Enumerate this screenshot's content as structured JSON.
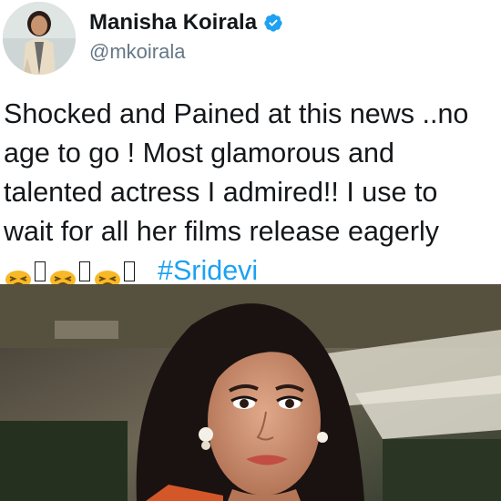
{
  "author": {
    "display_name": "Manisha Koirala",
    "handle": "@mkoirala",
    "verified": true,
    "verified_badge_color": "#1da1f2"
  },
  "tweet": {
    "lines": [
      "Shocked and Pained at this news ..no",
      "age to go ! Most glamorous and",
      "talented actress I admired!! I use to",
      "wait for all her films release eagerly"
    ],
    "emoji_sequence": [
      "persevering-face-emoji",
      "missing-glyph",
      "persevering-face-emoji",
      "missing-glyph",
      "persevering-face-emoji",
      "missing-glyph"
    ],
    "hashtag": "#Sridevi"
  },
  "colors": {
    "text": "#14171a",
    "secondary_text": "#657786",
    "link": "#1da1f2",
    "emoji": "#f7b928"
  },
  "media": {
    "icon": "attached-photo"
  }
}
